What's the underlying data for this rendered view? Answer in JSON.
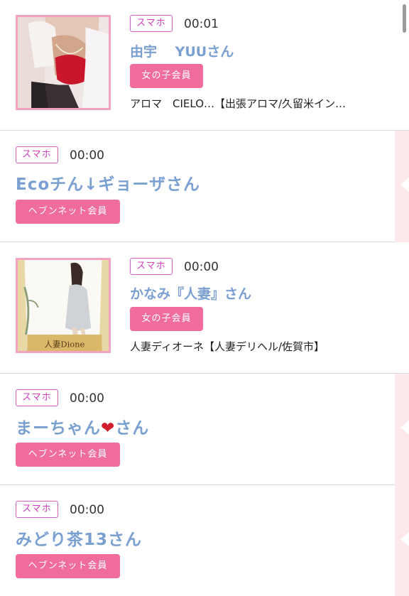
{
  "items": [
    {
      "tag": "スマホ",
      "time": "00:01",
      "name": "由宇　 YUUさん",
      "member": "女の子会員",
      "shop": "アロマ　CIELO…【出張アロマ/久留米イン…",
      "thumb": "photo-woman-red-top"
    },
    {
      "tag": "スマホ",
      "time": "00:00",
      "name": "Ecoチん↓ギョーザさん",
      "member": "ヘブンネット会員"
    },
    {
      "tag": "スマホ",
      "time": "00:00",
      "name": "かなみ『人妻』さん",
      "member": "女の子会員",
      "shop": "人妻ディオーネ【人妻デリヘル/佐賀市】",
      "thumb": "photo-woman-white-dress",
      "thumb_logo": "人妻Dione"
    },
    {
      "tag": "スマホ",
      "time": "00:00",
      "name_prefix": "まーちゃん",
      "name_heart": "❤",
      "name_suffix": "さん",
      "member": "ヘブンネット会員"
    },
    {
      "tag": "スマホ",
      "time": "00:00",
      "name": "みどり茶13さん",
      "member": "ヘブンネット会員"
    }
  ],
  "colors": {
    "name_blue": "#7aa0d2",
    "badge_pink": "#f06c9c",
    "tag_magenta": "#cf3fbe",
    "thumb_border": "#f3a3bf",
    "rail_pink": "#fde8ec"
  }
}
